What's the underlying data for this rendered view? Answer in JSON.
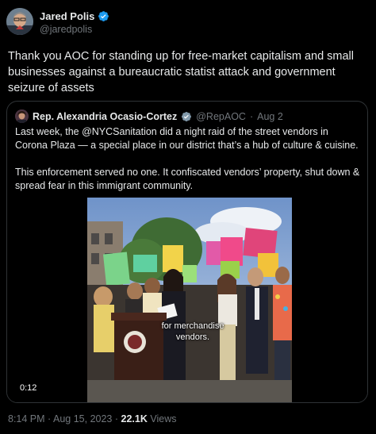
{
  "author": {
    "name": "Jared Polis",
    "handle": "@jaredpolis",
    "verified_icon": "verified-badge-icon"
  },
  "tweet": {
    "text": "Thank you AOC for standing up for free-market capitalism and small businesses against a bureaucratic statist attack and government seizure of assets"
  },
  "quote": {
    "name": "Rep. Alexandria Ocasio-Cortez",
    "handle": "@RepAOC",
    "separator": "·",
    "date": "Aug 2",
    "paragraph1": "Last week, the @NYCSanitation did a night raid of the street vendors in Corona Plaza — a special place in our district that’s a hub of culture & cuisine.",
    "paragraph2": "This enforcement served no one. It confiscated vendors’ property, shut down & spread fear in this immigrant community.",
    "video": {
      "caption_line1": "for merchandise",
      "caption_line2": "vendors.",
      "timecode": "0:12"
    }
  },
  "footer": {
    "time": "8:14 PM",
    "separator": "·",
    "date": "Aug 15, 2023",
    "separator2": "·",
    "views_count": "22.1K",
    "views_label": "Views"
  },
  "colors": {
    "background": "#000000",
    "text": "#e7e9ea",
    "secondary": "#71767b",
    "verified": "#1d9bf0"
  }
}
